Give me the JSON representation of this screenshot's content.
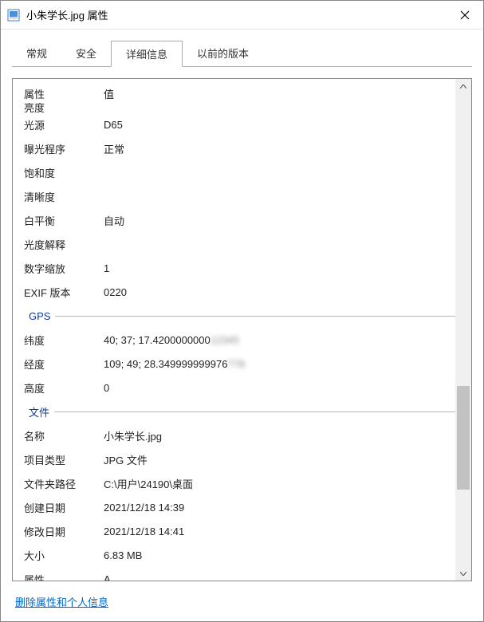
{
  "window": {
    "title": "小朱学长.jpg 属性"
  },
  "tabs": {
    "general": "常规",
    "security": "安全",
    "details": "详细信息",
    "previous": "以前的版本"
  },
  "headers": {
    "property": "属性",
    "value": "值"
  },
  "cutRow": "亮度",
  "rows": {
    "lightSource": {
      "label": "光源",
      "value": "D65"
    },
    "exposureProgram": {
      "label": "曝光程序",
      "value": "正常"
    },
    "saturation": {
      "label": "饱和度",
      "value": ""
    },
    "sharpness": {
      "label": "清晰度",
      "value": ""
    },
    "whiteBalance": {
      "label": "白平衡",
      "value": "自动"
    },
    "photometric": {
      "label": "光度解释",
      "value": ""
    },
    "digitalZoom": {
      "label": "数字缩放",
      "value": "1"
    },
    "exifVersion": {
      "label": "EXIF 版本",
      "value": "0220"
    }
  },
  "sections": {
    "gps": "GPS",
    "file": "文件"
  },
  "gps": {
    "latitude": {
      "label": "纬度",
      "value": "40; 37; 17.4200000000",
      "tail": "12345"
    },
    "longitude": {
      "label": "经度",
      "value": "109; 49; 28.349999999976",
      "tail": "778"
    },
    "altitude": {
      "label": "高度",
      "value": "0"
    }
  },
  "file": {
    "name": {
      "label": "名称",
      "value": "小朱学长.jpg"
    },
    "itemType": {
      "label": "项目类型",
      "value": "JPG 文件"
    },
    "folderPath": {
      "label": "文件夹路径",
      "value": "C:\\用户\\24190\\桌面"
    },
    "created": {
      "label": "创建日期",
      "value": "2021/12/18 14:39"
    },
    "modified": {
      "label": "修改日期",
      "value": "2021/12/18 14:41"
    },
    "size": {
      "label": "大小",
      "value": "6.83 MB"
    },
    "attributes": {
      "label": "属性",
      "value": "A"
    }
  },
  "link": "删除属性和个人信息"
}
